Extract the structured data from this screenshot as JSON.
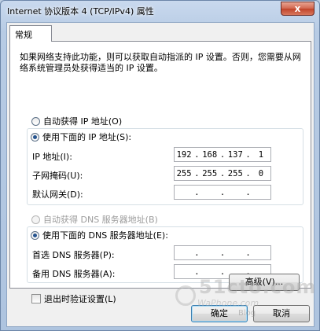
{
  "window": {
    "title": "Internet 协议版本 4 (TCP/IPv4) 属性",
    "close_symbol": "x"
  },
  "tabs": [
    {
      "label": "常规",
      "active": true
    }
  ],
  "description": "如果网络支持此功能，则可以获取自动指派的 IP 设置。否则，您需要从网络系统管理员处获得适当的 IP 设置。",
  "ip_section": {
    "auto_label": "自动获得 IP 地址(O)",
    "manual_label": "使用下面的 IP 地址(S):",
    "selected": "manual",
    "fields": [
      {
        "label": "IP 地址(I):",
        "octets": [
          "192",
          "168",
          "137",
          "1"
        ]
      },
      {
        "label": "子网掩码(U):",
        "octets": [
          "255",
          "255",
          "255",
          "0"
        ]
      },
      {
        "label": "默认网关(D):",
        "octets": [
          "",
          "",
          "",
          ""
        ]
      }
    ]
  },
  "dns_section": {
    "auto_label": "自动获得 DNS 服务器地址(B)",
    "manual_label": "使用下面的 DNS 服务器地址(E):",
    "selected": "manual",
    "fields": [
      {
        "label": "首选 DNS 服务器(P):",
        "octets": [
          "",
          "",
          "",
          ""
        ]
      },
      {
        "label": "备用 DNS 服务器(A):",
        "octets": [
          "",
          "",
          "",
          ""
        ]
      }
    ]
  },
  "validate_on_exit": {
    "label": "退出时验证设置(L)",
    "checked": false
  },
  "buttons": {
    "advanced": "高级(V)...",
    "ok": "确定",
    "cancel": "取消"
  },
  "watermark": {
    "brand": "51cto.com",
    "tagline": "WaPhone.com",
    "url": "Blog"
  },
  "colors": {
    "title_gradient_top": "#c9d9ee",
    "close_button": "#c0432a",
    "radio_dot": "#26548f",
    "default_button_border": "#3c7fb1"
  }
}
